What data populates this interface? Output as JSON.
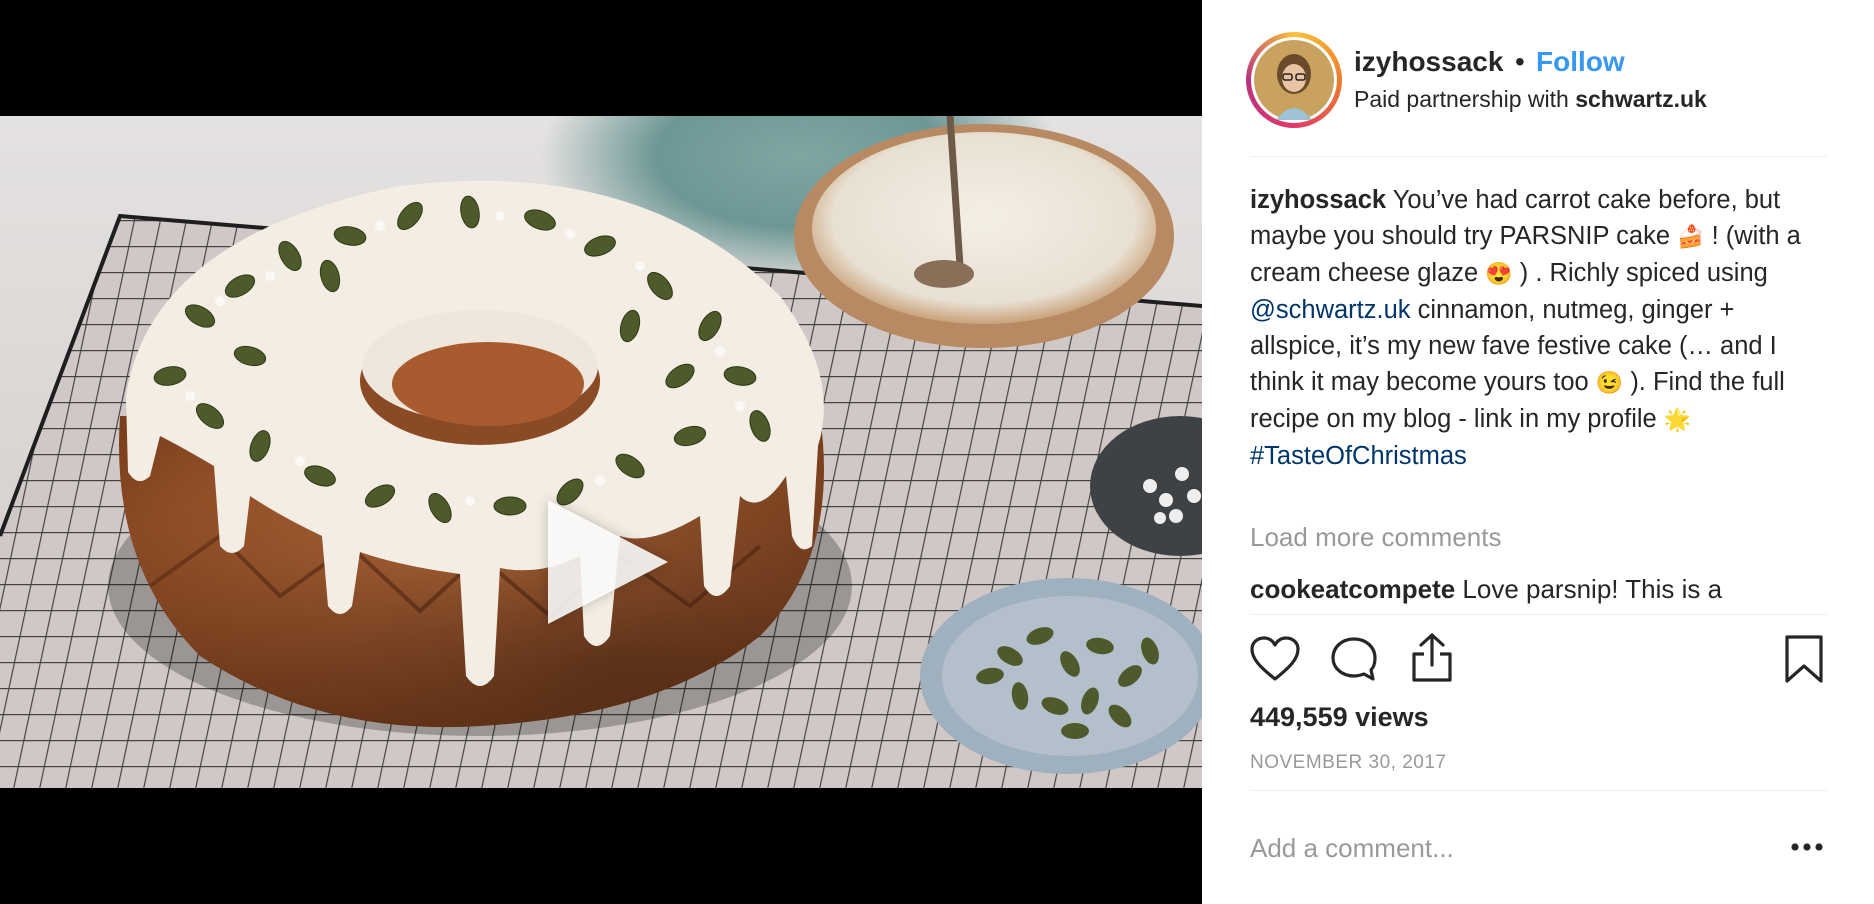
{
  "post": {
    "username": "izyhossack",
    "separator": "•",
    "follow_label": "Follow",
    "partnership_prefix": "Paid partnership with ",
    "partner": "schwartz.uk"
  },
  "caption": {
    "username": "izyhossack",
    "text_1": " You’ve had carrot cake before, but maybe you should try PARSNIP cake ",
    "emoji_cake": "🍰",
    "text_2": " ! (with a cream cheese glaze ",
    "emoji_heart_eyes": "😍",
    "text_3": " ) . Richly spiced using ",
    "mention": "@schwartz.uk",
    "text_4": " cinnamon, nutmeg, ginger + allspice, it’s my new fave festive cake (… and I think it may become yours too ",
    "emoji_wink": "😉",
    "text_5": " ). Find the full recipe on my blog - link in my profile ",
    "emoji_star": "🌟",
    "hashtag": "#TasteOfChristmas"
  },
  "comments": {
    "load_more_label": "Load more comments",
    "items": [
      {
        "username": "cookeatcompete",
        "text": " Love parsnip! This is a"
      }
    ]
  },
  "actions": {
    "icons": [
      "heart-icon",
      "comment-icon",
      "share-icon",
      "bookmark-icon"
    ]
  },
  "stats": {
    "views": "449,559 views",
    "date": "NOVEMBER 30, 2017"
  },
  "composer": {
    "placeholder": "Add a comment..."
  },
  "colors": {
    "follow": "#3897f0",
    "link": "#003569",
    "muted": "#999999",
    "text": "#262626"
  }
}
